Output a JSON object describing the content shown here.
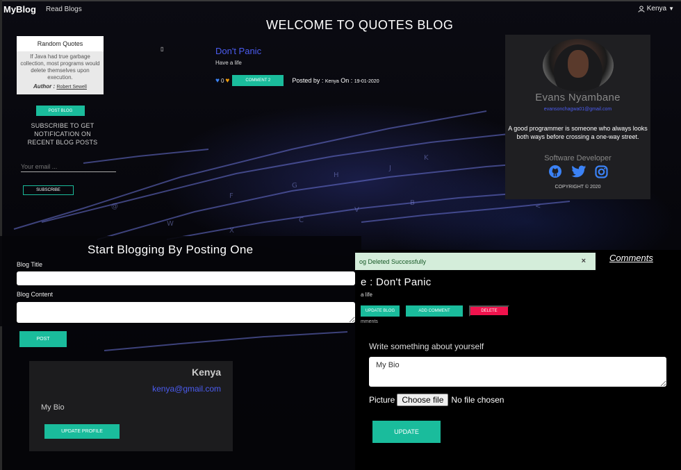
{
  "navbar": {
    "brand": "MyBlog",
    "read_blogs": "Read Blogs",
    "user_name": "Kenya"
  },
  "hero": {
    "welcome": "WELCOME TO QUOTES BLOG"
  },
  "random_quote": {
    "header": "Random Quotes",
    "text": "If Java had true garbage collection, most programs would delete themselves upon execution.",
    "author_label": "Author :",
    "author_name": "Robert Sewell"
  },
  "sidebar": {
    "post_blog_label": "POST BLOG",
    "subscribe_text": "SUBSCRIBE TO GET NOTIFICATION ON RECENT BLOG POSTS",
    "email_placeholder": "Your email ...",
    "subscribe_label": "SUBSCRIBE"
  },
  "post": {
    "title": "Don't Panic",
    "subtitle": "Have a life",
    "likes": "0",
    "comment_label": "COMMENT 2",
    "posted_by_label": "Posted by :",
    "posted_by_name": "Kenya",
    "on_label": "On :",
    "date": "19-01-2020"
  },
  "profile": {
    "name": "Evans Nyambane",
    "email": "evansonchagwa01@gmail.com",
    "quote": "A good programmer is someone who always looks both ways before crossing a one-way street.",
    "role": "Software Developer",
    "copyright": "COPYRIGHT © 2020",
    "socials": [
      "github-icon",
      "twitter-icon",
      "instagram-icon"
    ]
  },
  "new_post_form": {
    "heading": "Start Blogging By Posting One",
    "title_label": "Blog Title",
    "content_label": "Blog Content",
    "post_label": "POST"
  },
  "alert": {
    "message": "og Deleted Successfully",
    "close": "×"
  },
  "comments_link": "Comments",
  "post_detail": {
    "title": "e : Don't Panic",
    "subtitle": "a life",
    "update_blog_label": "UPDATE BLOG",
    "add_comment_label": "ADD COMMENT",
    "delete_label": "DELETE",
    "comments_text": "mments"
  },
  "bio_form": {
    "label": "Write something about yourself",
    "value": "My Bio",
    "picture_label": "Picture",
    "choose_file": "Choose file",
    "no_file": "No file chosen",
    "update_label": "UPDATE"
  },
  "user_card": {
    "name": "Kenya",
    "email": "kenya@gmail.com",
    "bio": "My Bio",
    "update_profile_label": "UPDATE PROFILE"
  },
  "colors": {
    "teal": "#1abc9c",
    "link_blue": "#4b5cf0",
    "delete_red": "#f0134d",
    "alert_green": "#d4edda"
  }
}
